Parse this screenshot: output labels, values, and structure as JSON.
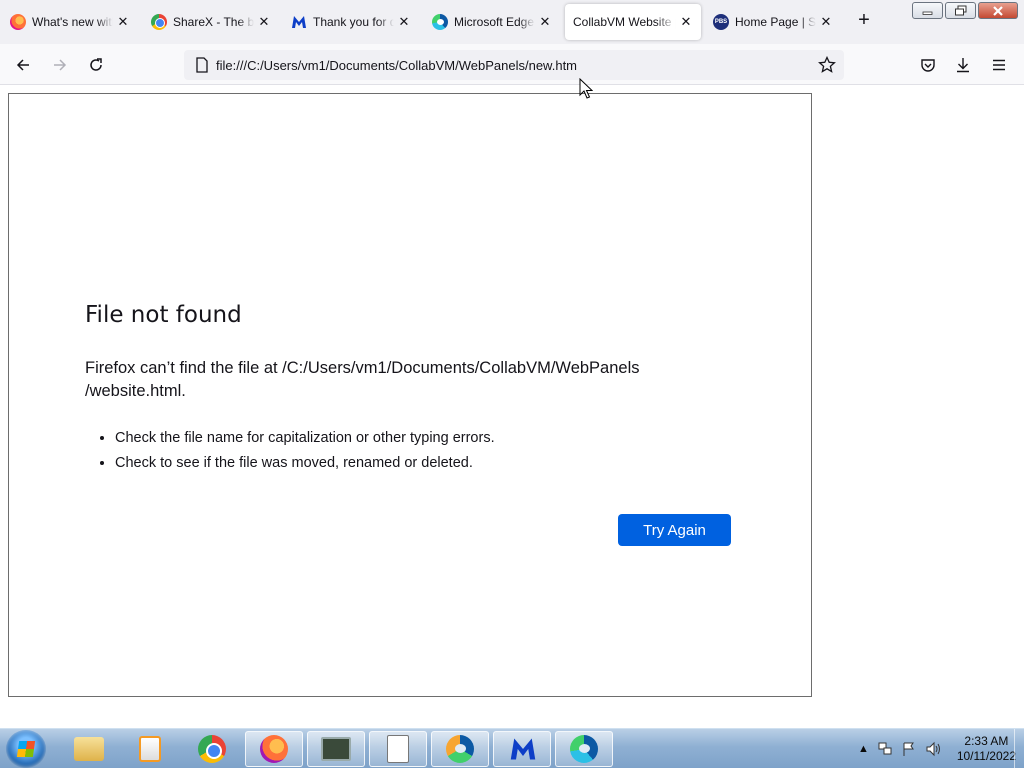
{
  "tabs": [
    {
      "title": "What's new with",
      "icon": "firefox-icon",
      "active": false
    },
    {
      "title": "ShareX - The be",
      "icon": "chrome-icon",
      "active": false
    },
    {
      "title": "Thank you for d",
      "icon": "malwarebytes-icon",
      "active": false
    },
    {
      "title": "Microsoft Edge",
      "icon": "edge-icon",
      "active": false
    },
    {
      "title": "CollabVM Website p",
      "icon": "none",
      "active": true
    },
    {
      "title": "Home Page | Se",
      "icon": "pbs-icon",
      "active": false
    }
  ],
  "navbar": {
    "url": "file:///C:/Users/vm1/Documents/CollabVM/WebPanels/new.htm"
  },
  "error": {
    "title": "File not found",
    "description": "Firefox can’t find the file at /C:/Users/vm1/Documents/CollabVM/WebPanels /website.html.",
    "items": [
      "Check the file name for capitalization or other typing errors.",
      "Check to see if the file was moved, renamed or deleted."
    ],
    "button": "Try Again"
  },
  "taskbar": {
    "apps": [
      "windows-explorer",
      "windows-media-player",
      "google-chrome",
      "firefox",
      "task-manager",
      "notepad",
      "edge-dev",
      "malwarebytes",
      "microsoft-edge"
    ],
    "time": "2:33 AM",
    "date": "10/11/2022"
  },
  "colors": {
    "accent": "#0061e0",
    "tabstrip": "#f0f0f4"
  }
}
